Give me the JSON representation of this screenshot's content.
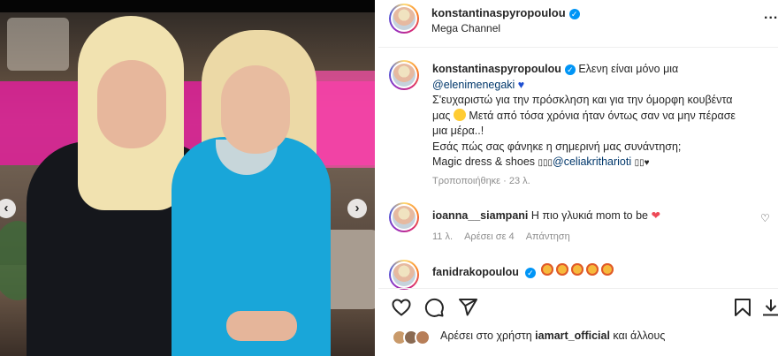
{
  "post": {
    "header": {
      "username": "konstantinaspyropoulou",
      "location": "Mega Channel",
      "more_label": "..."
    },
    "caption": {
      "username": "konstantinaspyropoulou",
      "line1": "Ελενη είναι μόνο μια",
      "mention1": "@elenimenegaki",
      "line2": "Σ'ευχαριστώ για την πρόσκληση και για την όμορφη κουβέντα",
      "line3": "μας",
      "line3b": "Μετά από τόσα χρόνια ήταν όντως σαν να μην πέρασε",
      "line4": "μια μέρα..!",
      "line5": "Εσάς πώς σας φάνηκε η σημερινή μας συνάντηση;",
      "line6": "Magic dress & shoes",
      "mention2": "@celiakritharioti",
      "edited": "Τροποποιήθηκε · 23 λ."
    },
    "comments": [
      {
        "username": "ioanna__siampani",
        "text": "Η πιο γλυκιά mom to be",
        "time": "11 λ.",
        "likes": "Αρέσει σε 4",
        "reply": "Απάντηση"
      },
      {
        "username": "fanidrakopoulou"
      }
    ],
    "likes_line": {
      "prefix": "Αρέσει στο χρήστη",
      "user": "iamart_official",
      "suffix": "και άλλους"
    }
  },
  "icons": {
    "heart": "heart-icon",
    "comment": "comment-icon",
    "share": "share-icon",
    "save": "bookmark-icon",
    "download": "download-icon",
    "verified": "verified-badge-icon"
  },
  "colors": {
    "mention": "#00376b",
    "verified": "#0095f6",
    "muted": "#8e8e8e",
    "dress": "#19a6d9"
  }
}
